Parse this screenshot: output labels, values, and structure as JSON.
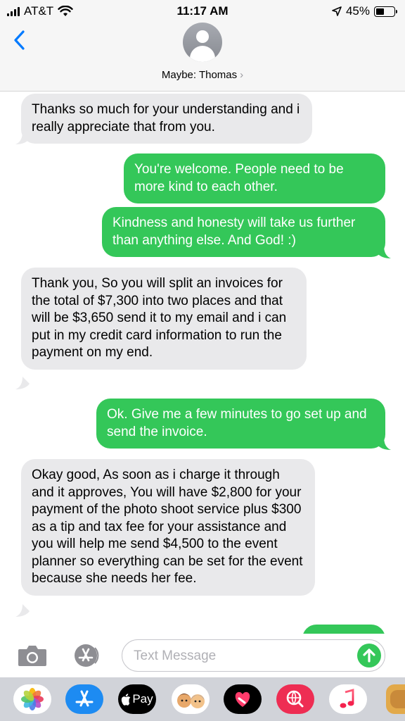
{
  "status_bar": {
    "carrier": "AT&T",
    "time": "11:17 AM",
    "battery": "45%",
    "battery_level": 0.45
  },
  "header": {
    "contact_name": "Maybe: Thomas",
    "back_icon": "chevron-left-icon",
    "avatar_icon": "person-silhouette-icon",
    "chevron": "›"
  },
  "messages": [
    {
      "direction": "incoming",
      "text": "Thanks so much for your understanding and i really appreciate that from you."
    },
    {
      "direction": "outgoing",
      "text": "You're welcome. People need to be more kind to each other."
    },
    {
      "direction": "outgoing",
      "text": "Kindness and honesty will take us further than anything else. And God! :)"
    },
    {
      "direction": "incoming",
      "text": "Thank you, So you will split an invoices for the total of $7,300 into two places and that will be $3,650 send it to my email and i can put in my credit card information to run the payment on my end."
    },
    {
      "direction": "outgoing",
      "text": "Ok. Give me a few minutes to go set up and send the invoice."
    },
    {
      "direction": "incoming",
      "text": "Okay good, As soon as i charge it through and it approves, You will have $2,800 for your payment of the photo shoot service plus $300 as a tip and tax fee for your assistance and you will help me send $4,500 to the event planner so everything can be set for the event because she needs her fee."
    }
  ],
  "input": {
    "placeholder": "Text Message",
    "value": ""
  },
  "drawer": {
    "apps": [
      {
        "name": "Photos",
        "icon": "photos-icon"
      },
      {
        "name": "App Store",
        "icon": "app-store-icon"
      },
      {
        "name": "Apple Pay",
        "label": "Pay",
        "icon": "apple-pay-icon"
      },
      {
        "name": "Memoji",
        "icon": "memoji-icon"
      },
      {
        "name": "Digital Touch",
        "icon": "digital-touch-icon"
      },
      {
        "name": "Images Search",
        "icon": "images-search-icon"
      },
      {
        "name": "Music",
        "icon": "music-icon"
      },
      {
        "name": "More",
        "icon": "app-partial-icon"
      }
    ]
  },
  "colors": {
    "outgoing_bubble": "#34c759",
    "incoming_bubble": "#e9e9eb",
    "accent": "#007aff"
  }
}
